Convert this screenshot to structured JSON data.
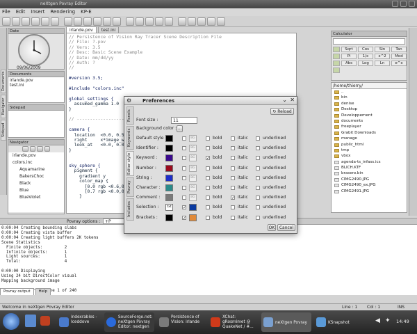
{
  "window": {
    "title": "neXtgen Povray Editor"
  },
  "menu": [
    "File",
    "Edit",
    "Insert",
    "Rendering",
    "KP-E"
  ],
  "left": {
    "date_header": "Date",
    "date": "09/06/2009",
    "documents_header": "Documents",
    "documents": [
      "irlande.pov",
      "test.ini"
    ],
    "navigator_header": "Navigator",
    "nav_items": [
      "irlande.pov",
      "colors.inc",
      "Aquamarine",
      "BakersChoc",
      "Black",
      "Blue",
      "BlueViolet"
    ],
    "tabs": [
      "Documents",
      "Navigator",
      "Sidepad"
    ]
  },
  "editor": {
    "tabs": [
      "irlande.pov",
      "test.ini"
    ],
    "lines": [
      "// Persistence of Vision Ray Tracer Scene Description File",
      "// File: ?.pov",
      "// Vers: 3.5",
      "// Desc: Basic Scene Example",
      "// Date: mm/dd/yy",
      "// Auth: ?",
      "//",
      "",
      "#version 3.5;",
      "",
      "#include \"colors.inc\"",
      "",
      "global_settings {",
      "  assumed_gamma 1.0",
      "}",
      "",
      "// -------------------------------------------",
      "",
      "camera {",
      "  location  <0.0, 0.5, -4.0>",
      "  right     x*image_width/image_height",
      "  look_at   <0.0, 0.0, 0.0>",
      "}",
      "",
      "",
      "sky_sphere {",
      "  pigment {",
      "    gradient y",
      "    color_map {",
      "      [0.0 rgb <0.6,0.7,1.0>]",
      "      [0.7 rgb <0.0,0.1,0.8>]",
      "    }"
    ]
  },
  "calc": {
    "header": "Calculator",
    "keys": [
      "Sqrt",
      "Cos",
      "Sin",
      "Tan",
      "Pi",
      "1/x",
      "x^2",
      "Mod",
      "Abs",
      "Log",
      "Ln",
      "e^x"
    ]
  },
  "files": {
    "path": "/home/thierry/",
    "items": [
      "..",
      "bin",
      "denise",
      "Desktop",
      "Developpement",
      "documents",
      "freeplayer",
      "Grabit Downloads",
      "manage",
      "public_html",
      "tmp",
      "vbox",
      "agenda-ts_infass.ics",
      "BLICH.KTF",
      "brasero.bin",
      "CIMG2490.JPG",
      "CIMG2490_ex.JPG",
      "CIMG2491.JPG"
    ]
  },
  "output": {
    "options_label": "Povray options :",
    "option_value": "+P",
    "lines": [
      "0:00:04 Creating bounding slabs",
      "0:00:04 Creating vista buffer",
      "0:00:04 Creating light buffers 2K tokens",
      "Scene Statistics",
      "  Finite objects:         2",
      "  Infinite objects:       1",
      "  Light sources:          1",
      "  Total:                  4",
      "",
      "0:00:00 Displaying",
      "Using 24 bit DirectColor visual",
      "Mapping background image",
      "",
      "0:00:00 Rendering line 1 of 240"
    ],
    "tabs": [
      "Povray output",
      "Help"
    ]
  },
  "status": {
    "message": "Welcome in neXtgen Povray Editor",
    "line": "Line : 1",
    "col": "Col : 1",
    "mode": "INS"
  },
  "taskbar": {
    "tasks": [
      "indexrables - Iceddove",
      "SourceForge.net: neXtgen Povray Editor: nextgen",
      "Persistence of Vision: irlande",
      "XChat: gRosmimet @ QuakeNet / #...",
      "neXtgen Povray Editor",
      "KSnapshot"
    ],
    "clock": "14:49"
  },
  "dialog": {
    "title": "Preferences",
    "reload": "Reload",
    "font_label": "Font size :",
    "font_value": "11",
    "bg_label": "Background color :",
    "bg_btn": "...",
    "side_tabs": [
      "Panels",
      "Keywords",
      "Editor style",
      "Povray",
      "Includes"
    ],
    "bold": "bold",
    "italic": "italic",
    "underlined": "underlined",
    "bg_placeholder": "BG",
    "ok": "OK",
    "cancel": "Cancel",
    "styles": [
      {
        "name": "Default style :",
        "fg": "#000000",
        "bg": null,
        "bold": false,
        "italic": false,
        "under": false,
        "bgon": false
      },
      {
        "name": "Identifier :",
        "fg": "#000000",
        "bg": null,
        "bold": false,
        "italic": false,
        "under": false,
        "bgon": false
      },
      {
        "name": "Keyword :",
        "fg": "#3a0a8c",
        "bg": null,
        "bold": true,
        "italic": false,
        "under": false,
        "bgon": false
      },
      {
        "name": "Number :",
        "fg": "#9a0a1e",
        "bg": null,
        "bold": false,
        "italic": false,
        "under": false,
        "bgon": false
      },
      {
        "name": "String :",
        "fg": "#1e2ec8",
        "bg": null,
        "bold": false,
        "italic": false,
        "under": false,
        "bgon": false
      },
      {
        "name": "Character :",
        "fg": "#2a8a8a",
        "bg": null,
        "bold": false,
        "italic": false,
        "under": false,
        "bgon": false
      },
      {
        "name": "Comment :",
        "fg": "#7a7a7a",
        "bg": null,
        "bold": false,
        "italic": true,
        "under": false,
        "bgon": false
      },
      {
        "name": "Selection :",
        "fg": "#ffffff",
        "bg": "#0a3aa0",
        "bold": false,
        "italic": false,
        "under": false,
        "bgon": true
      },
      {
        "name": "Brackets :",
        "fg": "#000000",
        "bg": "#e08a3a",
        "bold": false,
        "italic": false,
        "under": false,
        "bgon": true
      }
    ]
  }
}
